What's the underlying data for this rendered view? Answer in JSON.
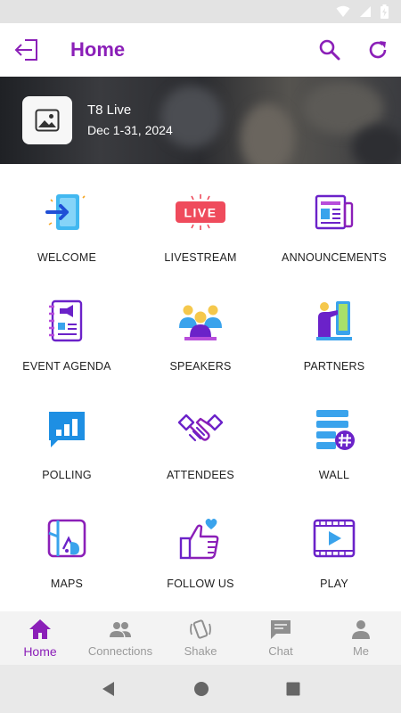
{
  "app": {
    "title": "Home",
    "accent_color": "#8b1fb8"
  },
  "status_bar": {
    "icons": [
      "wifi-icon",
      "cell-signal-icon",
      "battery-icon"
    ]
  },
  "toolbar": {
    "icons": [
      "logout-icon",
      "search-icon",
      "refresh-icon"
    ]
  },
  "event": {
    "name": "T8 Live",
    "dates": "Dec 1-31, 2024",
    "thumbnail_icon": "image-placeholder-icon"
  },
  "tiles": [
    {
      "label": "WELCOME",
      "icon": "welcome-door-icon"
    },
    {
      "label": "LIVESTREAM",
      "icon": "live-badge-icon",
      "badge_text": "LIVE"
    },
    {
      "label": "ANNOUNCEMENTS",
      "icon": "newspaper-icon"
    },
    {
      "label": "EVENT AGENDA",
      "icon": "agenda-notebook-icon"
    },
    {
      "label": "SPEAKERS",
      "icon": "speakers-group-icon"
    },
    {
      "label": "PARTNERS",
      "icon": "partner-presenter-icon"
    },
    {
      "label": "POLLING",
      "icon": "poll-chart-icon"
    },
    {
      "label": "ATTENDEES",
      "icon": "handshake-icon"
    },
    {
      "label": "WALL",
      "icon": "wall-hashtag-icon"
    },
    {
      "label": "MAPS",
      "icon": "map-icon"
    },
    {
      "label": "FOLLOW US",
      "icon": "thumbs-up-heart-icon"
    },
    {
      "label": "PLAY",
      "icon": "video-play-icon"
    }
  ],
  "bottom_nav": [
    {
      "label": "Home",
      "icon": "home-icon",
      "active": true
    },
    {
      "label": "Connections",
      "icon": "people-icon",
      "active": false
    },
    {
      "label": "Shake",
      "icon": "shake-phone-icon",
      "active": false
    },
    {
      "label": "Chat",
      "icon": "chat-bubble-icon",
      "active": false
    },
    {
      "label": "Me",
      "icon": "person-icon",
      "active": false
    }
  ],
  "system_nav": [
    "back-triangle-icon",
    "home-circle-icon",
    "recents-square-icon"
  ]
}
